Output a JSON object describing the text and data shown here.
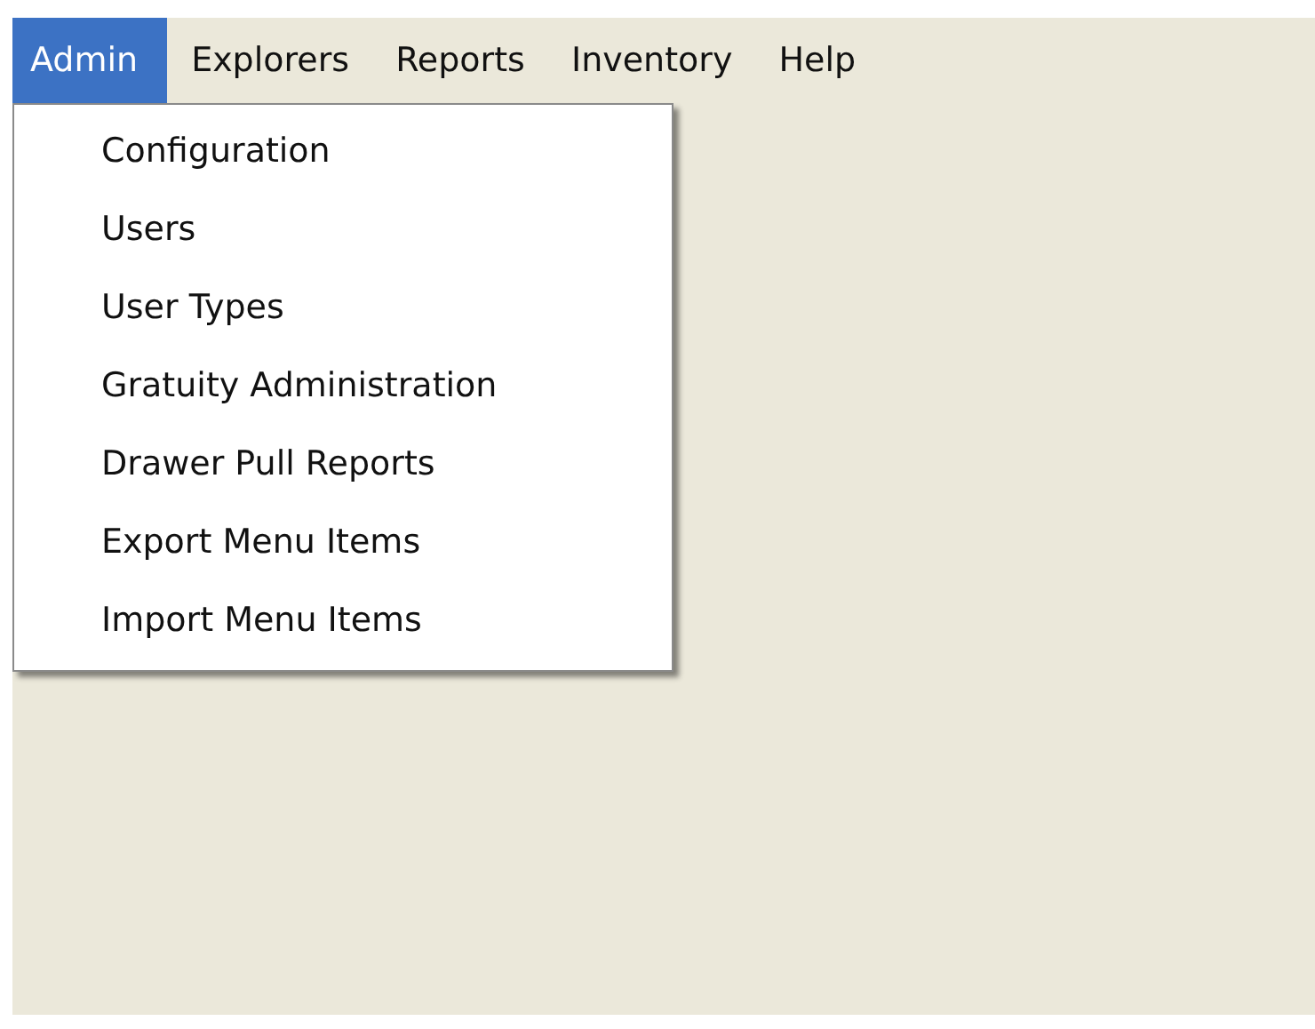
{
  "menu_bar": {
    "items": [
      {
        "label": "Admin",
        "selected": true
      },
      {
        "label": "Explorers",
        "selected": false
      },
      {
        "label": "Reports",
        "selected": false
      },
      {
        "label": "Inventory",
        "selected": false
      },
      {
        "label": "Help",
        "selected": false
      }
    ]
  },
  "dropdown": {
    "items": [
      {
        "label": "Configuration"
      },
      {
        "label": "Users"
      },
      {
        "label": "User Types"
      },
      {
        "label": "Gratuity Administration"
      },
      {
        "label": "Drawer Pull Reports"
      },
      {
        "label": "Export Menu Items"
      },
      {
        "label": "Import Menu Items"
      }
    ]
  }
}
